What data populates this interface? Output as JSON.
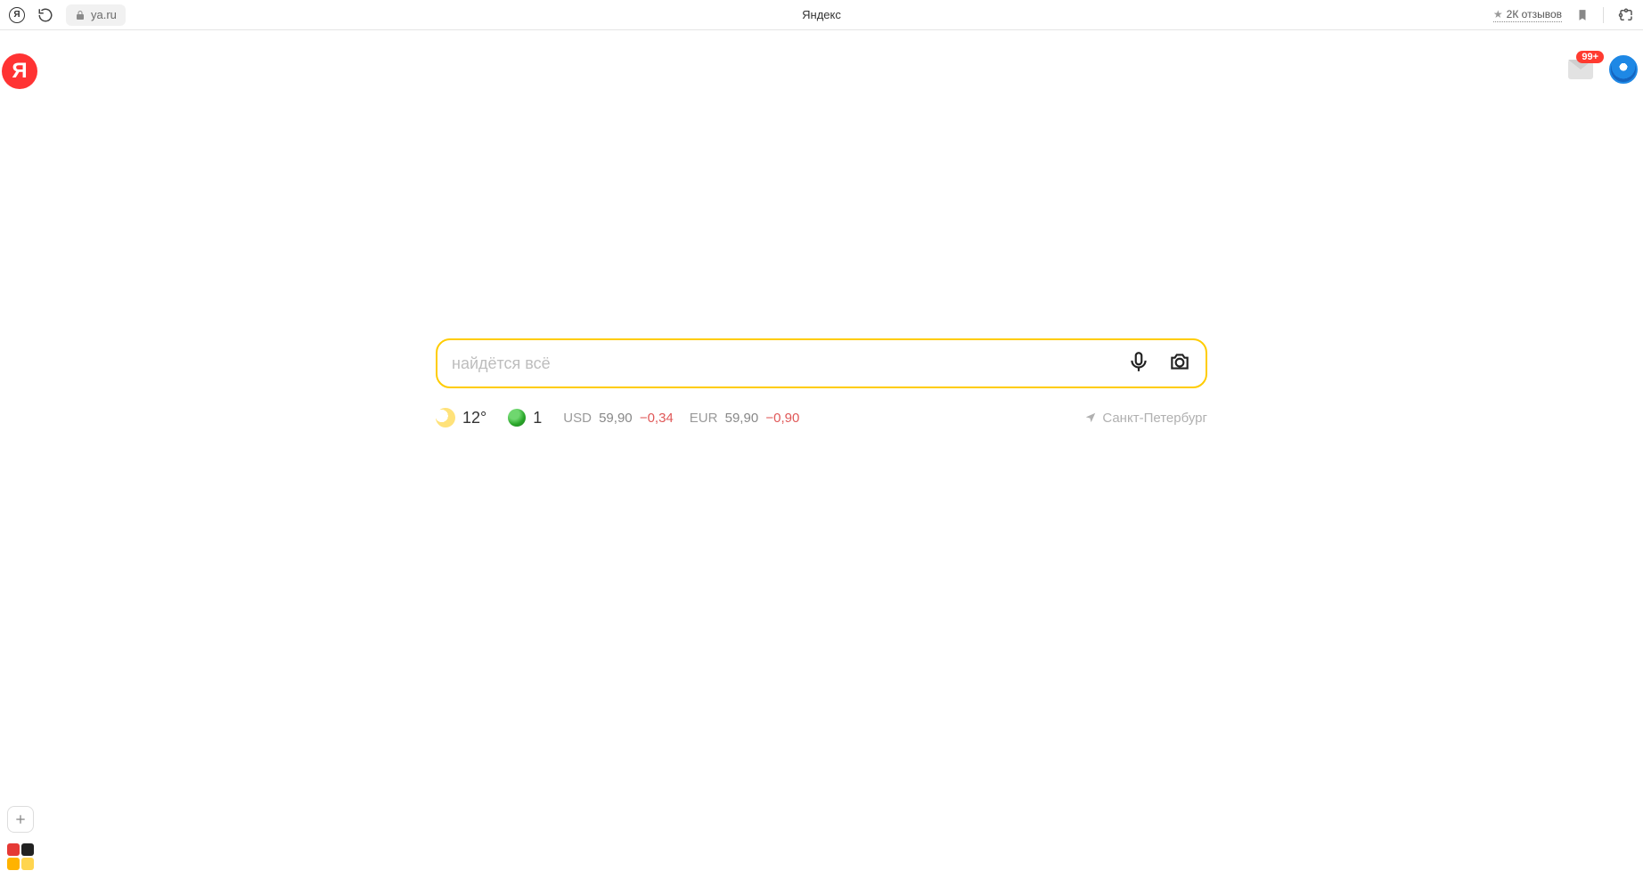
{
  "chrome": {
    "home_letter": "Я",
    "url": "ya.ru",
    "title": "Яндекс",
    "reviews": "2К отзывов"
  },
  "page": {
    "logo_letter": "Я",
    "mail_badge": "99+"
  },
  "search": {
    "placeholder": "найдётся всё",
    "value": ""
  },
  "weather": {
    "temp": "12°"
  },
  "traffic": {
    "level": "1"
  },
  "rates": [
    {
      "label": "USD",
      "value": "59,90",
      "delta": "−0,34"
    },
    {
      "label": "EUR",
      "value": "59,90",
      "delta": "−0,90"
    }
  ],
  "geo": {
    "city": "Санкт-Петербург"
  }
}
